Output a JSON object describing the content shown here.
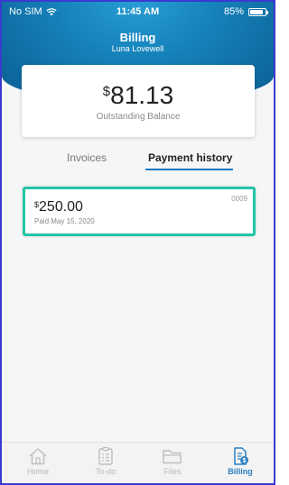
{
  "status_bar": {
    "carrier": "No SIM",
    "time": "11:45 AM",
    "battery": "85%",
    "battery_level": 0.85
  },
  "header": {
    "title": "Billing",
    "subtitle": "Luna Lovewell"
  },
  "balance": {
    "currency": "$",
    "amount": "81.13",
    "label": "Outstanding Balance"
  },
  "tabs": [
    {
      "label": "Invoices",
      "active": false
    },
    {
      "label": "Payment history",
      "active": true
    }
  ],
  "payments": [
    {
      "currency": "$",
      "amount": "250.00",
      "date": "Paid May 15, 2020",
      "number": "0009"
    }
  ],
  "tabbar": [
    {
      "label": "Home",
      "icon": "home-icon"
    },
    {
      "label": "To-do",
      "icon": "todo-icon"
    },
    {
      "label": "Files",
      "icon": "folder-icon"
    },
    {
      "label": "Billing",
      "icon": "billing-icon",
      "active": true
    }
  ],
  "colors": {
    "accent": "#1b78c0",
    "highlight": "#22c4a8",
    "header": "#1580b8",
    "frame": "#3a3ad0"
  }
}
